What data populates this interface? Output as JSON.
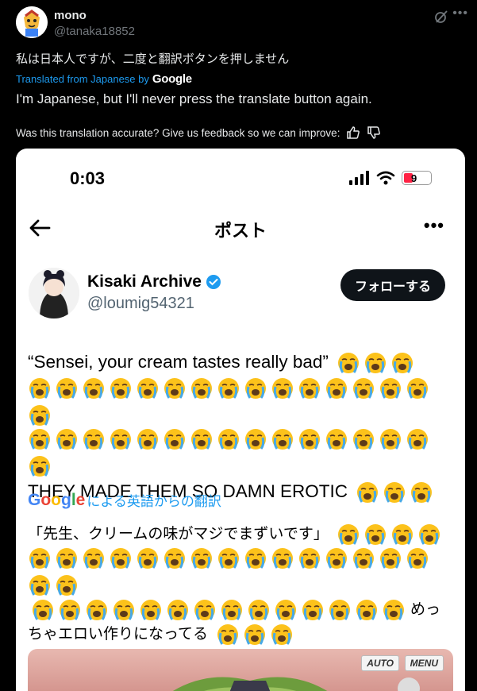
{
  "tweet": {
    "author_name": "mono",
    "author_handle": "@tanaka18852",
    "original_text": "私は日本人ですが、二度と翻訳ボタンを押しません",
    "translated_from": "Translated from Japanese by",
    "google_label": "Google",
    "translated_text": "I'm Japanese, but I'll never press the translate button again.",
    "feedback_text": "Was this translation accurate? Give us feedback so we can improve:"
  },
  "embed": {
    "status_time": "0:03",
    "battery": "9",
    "nav_title": "ポスト",
    "user_name": "Kisaki Archive",
    "user_handle": "@loumig54321",
    "follow_label": "フォローする",
    "english_text_1": "“Sensei, your cream tastes really bad”",
    "english_text_2": "THEY MADE THEM SO DAMN EROTIC",
    "google_translate_label": "による英語からの翻訳",
    "jp_text_1": "「先生、クリームの味がマジでまずいです」",
    "jp_text_2": "めっちゃエロい作りになってる",
    "media_auto": "AUTO",
    "media_menu": "MENU"
  },
  "colors": {
    "accent": "#1d9bf0",
    "background": "#000000",
    "embed_background": "#ffffff"
  },
  "icons": {
    "grok": "grok-icon",
    "more": "more-icon",
    "thumbs_up": "thumbs-up-icon",
    "thumbs_down": "thumbs-down-icon",
    "verified": "verified-badge-icon",
    "emoji": "loudly-crying-face-emoji"
  }
}
